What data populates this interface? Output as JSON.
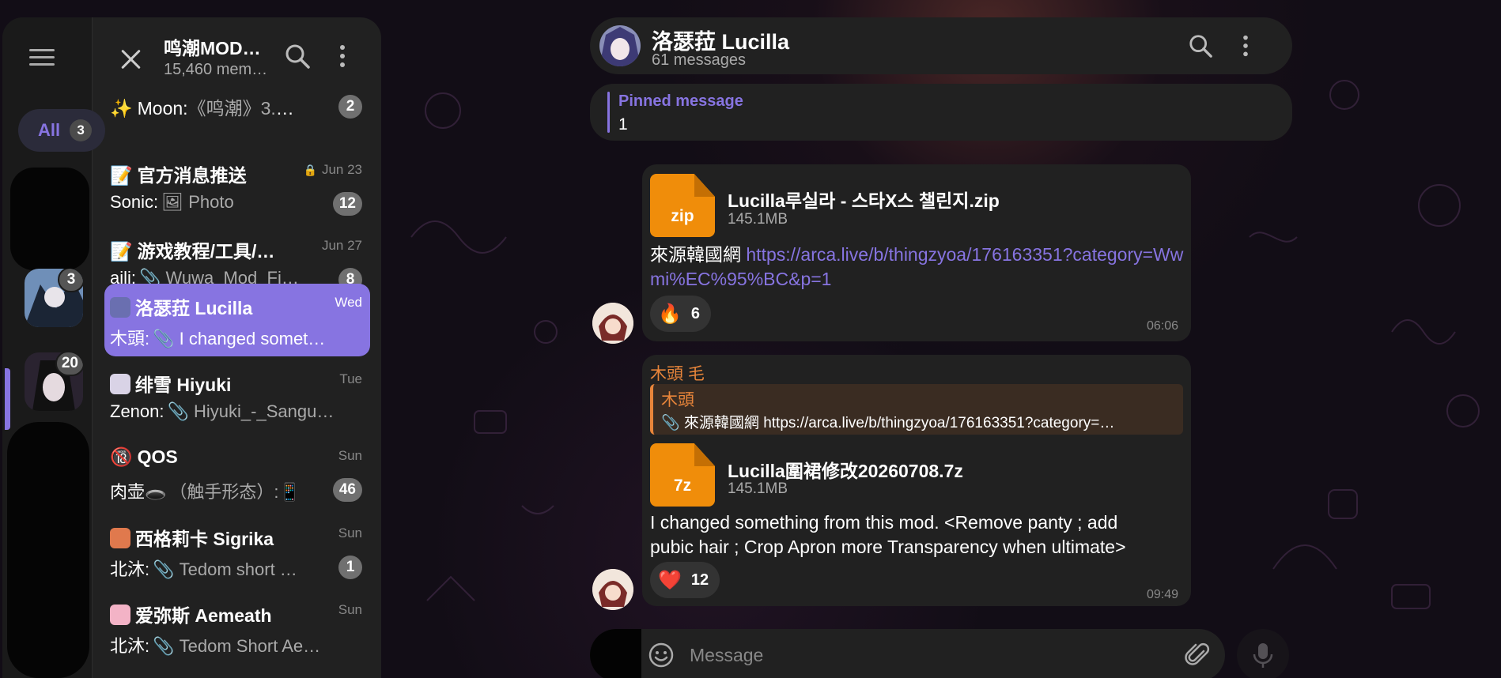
{
  "left": {
    "menu_icon": "hamburger-icon",
    "folders": {
      "all_label": "All",
      "all_count": "3",
      "avatar_badges": [
        "3",
        "20"
      ]
    },
    "chatlist": {
      "title": "鸣潮MOD…",
      "subtitle": "15,460 mem…",
      "items": [
        {
          "icon": "✨",
          "name": "Moon:",
          "message": "《鸣潮》3.5…",
          "date": "",
          "badge": "2",
          "sender": ""
        },
        {
          "icon": "📝",
          "name": "官方消息推送",
          "message": "🖼 Photo",
          "date": "Jun 23",
          "badge": "12",
          "sender": "Sonic:",
          "locked": true
        },
        {
          "icon": "📝",
          "name": "游戏教程/工具/…",
          "message": "📎 Wuwa_Mod_Fi…",
          "date": "Jun 27",
          "badge": "8",
          "sender": "aili:"
        },
        {
          "icon": "",
          "name": "洛瑟菈 Lucilla",
          "message": "📎 I changed somet…",
          "date": "Wed",
          "badge": "",
          "sender": "木頭:"
        },
        {
          "icon": "",
          "name": "绯雪 Hiyuki",
          "message": "📎 Hiyuki_-_Sangui…",
          "date": "Tue",
          "badge": "",
          "sender": "Zenon:"
        },
        {
          "icon": "🔞",
          "name": "QOS",
          "message": "（触手形态）:📱",
          "date": "Sun",
          "badge": "46",
          "sender": "肉壶🕳️"
        },
        {
          "icon": "",
          "name": "西格莉卡 Sigrika",
          "message": "📎 Tedom short …",
          "date": "Sun",
          "badge": "1",
          "sender": "北沐:"
        },
        {
          "icon": "",
          "name": "爱弥斯 Aemeath",
          "message": "📎 Tedom Short Ae…",
          "date": "Sun",
          "badge": "",
          "sender": "北沐:"
        }
      ]
    }
  },
  "chat": {
    "title": "洛瑟菈 Lucilla",
    "subtitle": "61 messages",
    "pinned_title": "Pinned message",
    "pinned_text": "1",
    "messages": [
      {
        "file_ext": "zip",
        "file_name": "Lucilla루실라 - 스타X스 챌린지.zip",
        "file_size": "145.1MB",
        "text_prefix": "來源韓國網",
        "link": "https://arca.live/b/thingzyoa/176163351?category=Wwmi%EC%95%BC&p=1",
        "reaction_emoji": "🔥",
        "reaction_count": "6",
        "time": "06:06"
      },
      {
        "sender": "木頭 毛",
        "reply_name": "木頭",
        "reply_text": "📎 來源韓國網 https://arca.live/b/thingzyoa/176163351?category=…",
        "file_ext": "7z",
        "file_name": "Lucilla圍裙修改20260708.7z",
        "file_size": "145.1MB",
        "text": "I changed something from this mod. <Remove panty ; add pubic hair ; Crop Apron more Transparency when ultimate>",
        "reaction_emoji": "❤️",
        "reaction_count": "12",
        "time": "09:49"
      }
    ],
    "composer_placeholder": "Message"
  },
  "colors": {
    "accent": "#8774e1",
    "panel": "#212121",
    "file_orange": "#f08d0a",
    "reply_orange": "#e8853a"
  }
}
